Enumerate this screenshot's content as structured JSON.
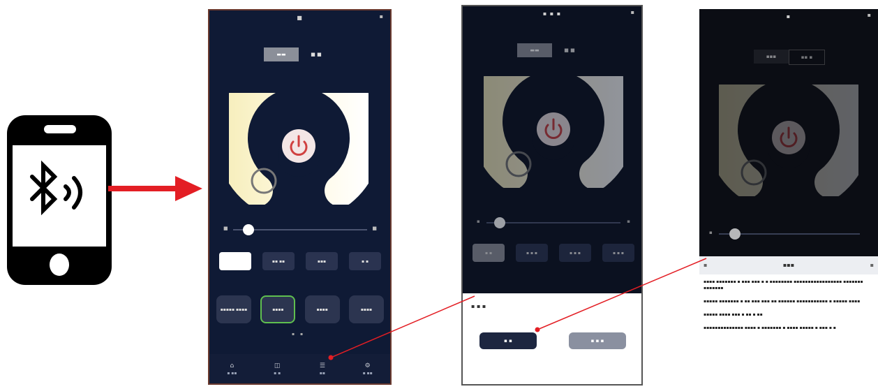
{
  "colors": {
    "arrow": "#e31e24",
    "screen_bg": "#0f1a35",
    "ring_warm": "#fff8d6",
    "ring_white": "#ffffff",
    "power_icon": "#d04040",
    "selected_border": "#5fbf4f"
  },
  "icons": {
    "phone": "bluetooth-phone-icon",
    "power": "power-icon",
    "callout_arrow": "red-arrow-icon"
  },
  "screen1": {
    "status_time": "■",
    "tabs": [
      "▬▬",
      "■ ■"
    ],
    "slider_left": "■",
    "slider_right": "■",
    "slider_value": 0.08,
    "presets_row1": [
      "",
      "▪▪ ▪▪",
      "▪▪▪",
      "▪ ▪"
    ],
    "presets_row2": [
      "▪▪▪▪▪ ▪▪▪▪",
      "▪▪▪▪",
      "▪▪▪▪",
      "▪▪▪▪"
    ],
    "page_dots": "▪ ▪",
    "nav": [
      {
        "icon": "⌂",
        "label": "▪ ▪▪"
      },
      {
        "icon": "◫",
        "label": "▪ ▪"
      },
      {
        "icon": "☰",
        "label": "▪▪"
      },
      {
        "icon": "⚙",
        "label": "▪ ▪▪"
      }
    ]
  },
  "screen2": {
    "status_time": "▪ ▪ ▪",
    "tabs": [
      "▬▬",
      "■ ■"
    ],
    "slider_left": "▪",
    "slider_right": "▪",
    "slider_value": 0.06,
    "presets_row1": [
      "▪ ▪",
      "▪ ▪ ▪",
      "▪ ▪ ▪",
      "▪ ▪ ▪"
    ],
    "dialog_title": "▪ ▪ ▪",
    "dialog_confirm": "▪ ▪",
    "dialog_cancel": "▪ ▪ ▪"
  },
  "screen3": {
    "status_time": "▪",
    "tabs": [
      "▪▪▪",
      "▪▪ ▪"
    ],
    "slider_left": "▪",
    "slider_value": 0.08,
    "sheet_title": "▪▪▪",
    "sheet_left": "▪",
    "sheet_right": "▪",
    "paragraphs": [
      "▪▪▪▪ ▪▪▪▪▪▪▪ ▪ ▪▪▪ ▪▪▪ ▪ ▪ ▪▪▪▪▪▪▪▪ ▪▪▪▪▪▪▪▪▪▪▪▪▪▪▪▪▪ ▪▪▪▪▪▪▪ ▪▪▪▪▪▪▪",
      "▪▪▪▪▪ ▪▪▪▪▪▪▪ ▪ ▪▪ ▪▪▪ ▪▪▪ ▪▪ ▪▪▪▪▪▪ ▪▪▪▪▪▪▪▪▪▪▪ ▪ ▪▪▪▪▪ ▪▪▪▪",
      "▪▪▪▪▪ ▪▪▪▪ ▪▪▪ ▪ ▪▪ ▪ ▪▪",
      "▪▪▪▪▪▪▪▪▪▪▪▪▪▪ ▪▪▪▪ ▪ ▪▪▪▪▪▪▪ ▪ ▪▪▪▪ ▪▪▪▪▪ ▪ ▪▪▪ ▪ ▪"
    ]
  }
}
